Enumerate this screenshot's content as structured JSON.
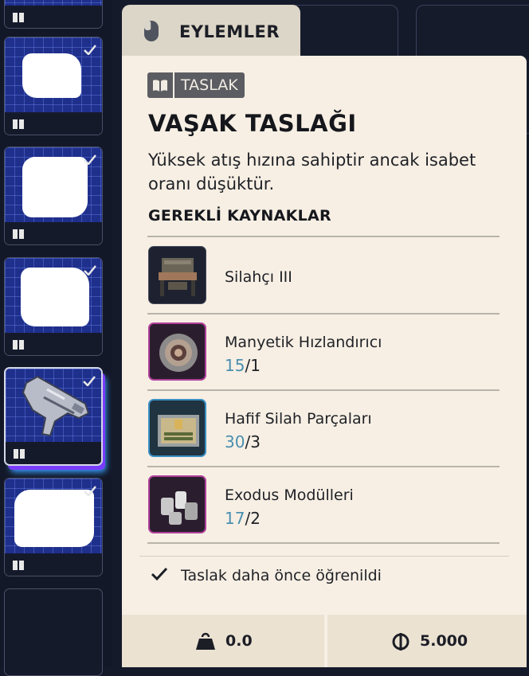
{
  "tab": {
    "label": "EYLEMLER",
    "icon": "mouse-icon"
  },
  "badge": {
    "label": "TASLAK",
    "icon": "book-icon"
  },
  "blueprint": {
    "title": "VAŞAK TASLAĞI",
    "description": "Yüksek atış hızına sahiptir ancak isabet oranı düşüktür."
  },
  "requirements": {
    "heading": "GEREKLİ KAYNAKLAR",
    "items": [
      {
        "name": "Silahçı III",
        "have": "",
        "sep": "",
        "need": "",
        "icon": "workbench-icon"
      },
      {
        "name": "Manyetik Hızlandırıcı",
        "have": "15",
        "sep": "/",
        "need": "1",
        "icon": "magnetic-accelerator-icon"
      },
      {
        "name": "Hafif Silah Parçaları",
        "have": "30",
        "sep": "/",
        "need": "3",
        "icon": "light-gun-parts-icon"
      },
      {
        "name": "Exodus Modülleri",
        "have": "17",
        "sep": "/",
        "need": "2",
        "icon": "exodus-modules-icon"
      }
    ]
  },
  "status": {
    "learned": "Taslak daha önce öğrenildi"
  },
  "footer": {
    "weight": "0.0",
    "price": "5.000"
  },
  "colors": {
    "panel": "#f7efe4",
    "accent_count": "#4a8fb0",
    "badge": "#5c5d62",
    "slot_bg": "#1f2f8c"
  }
}
